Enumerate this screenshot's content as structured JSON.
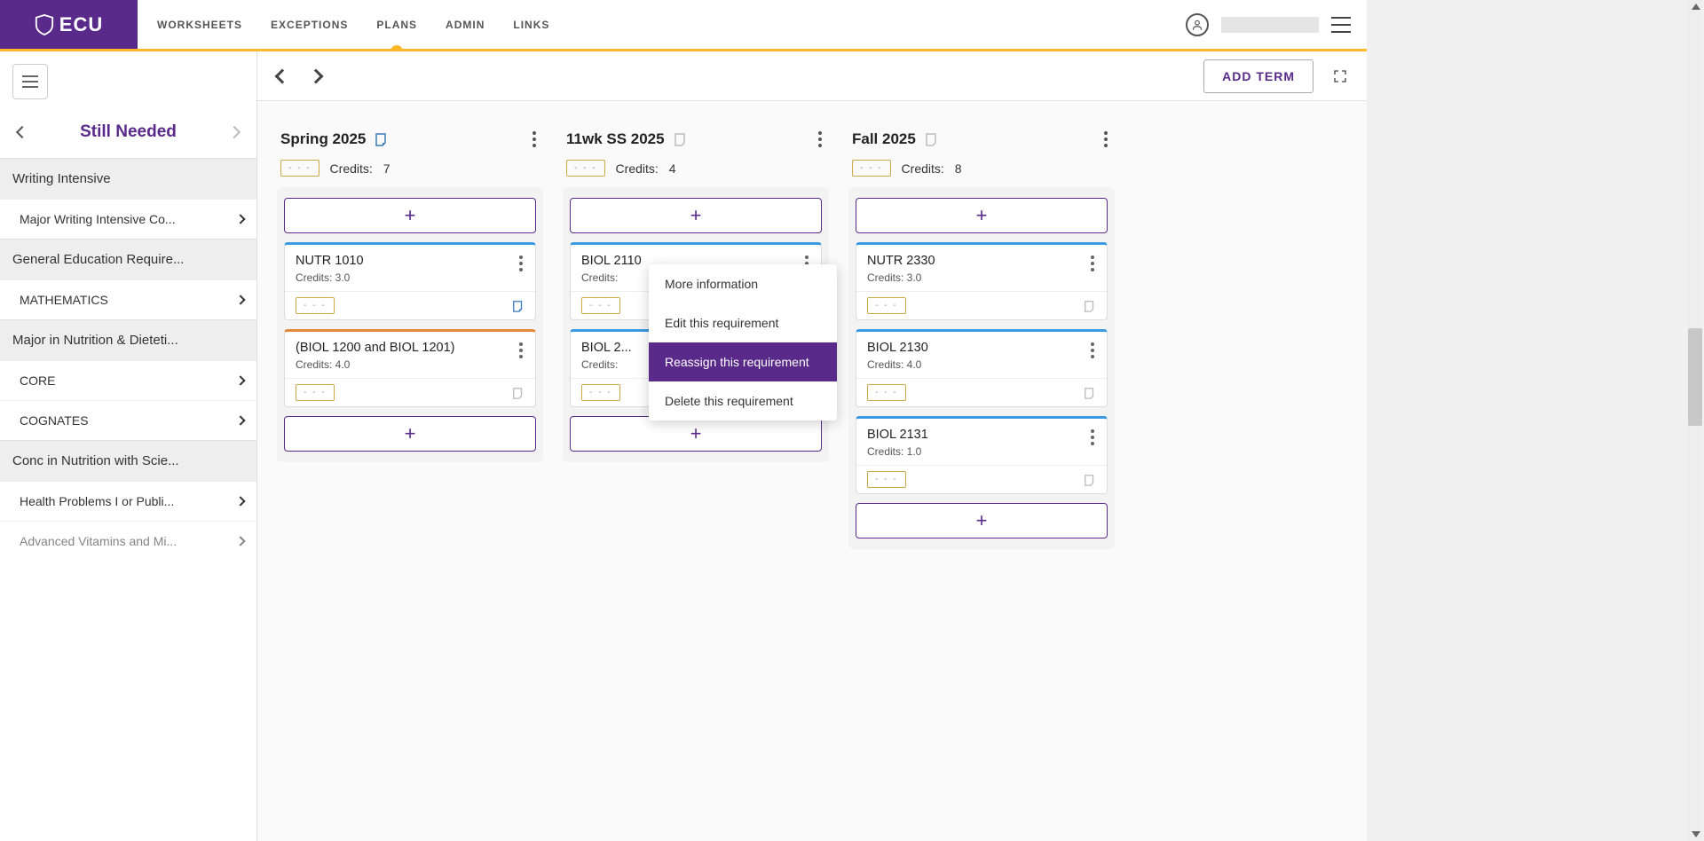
{
  "brand": "ECU",
  "nav": {
    "items": [
      "WORKSHEETS",
      "EXCEPTIONS",
      "PLANS",
      "ADMIN",
      "LINKS"
    ],
    "active_index": 2
  },
  "sidebar": {
    "title": "Still Needed",
    "groups": [
      {
        "type": "group",
        "label": "Writing Intensive"
      },
      {
        "type": "item",
        "label": "Major Writing Intensive Co..."
      },
      {
        "type": "group",
        "label": "General Education Require..."
      },
      {
        "type": "item",
        "label": "MATHEMATICS"
      },
      {
        "type": "group",
        "label": "Major in Nutrition & Dieteti..."
      },
      {
        "type": "item",
        "label": "CORE"
      },
      {
        "type": "item",
        "label": "COGNATES"
      },
      {
        "type": "group",
        "label": "Conc in Nutrition with Scie..."
      },
      {
        "type": "item",
        "label": "Health Problems I or Publi..."
      },
      {
        "type": "item",
        "label": "Advanced Vitamins and Mi..."
      }
    ]
  },
  "toolbar": {
    "add_term": "ADD TERM"
  },
  "dash_placeholder": "- - -",
  "credits_label": "Credits:",
  "terms": [
    {
      "title": "Spring 2025",
      "has_filled_note": true,
      "credits": "7",
      "courses": [
        {
          "name": "NUTR 1010",
          "credits": "Credits: 3.0",
          "accent": "blue",
          "note_filled": true
        },
        {
          "name": "(BIOL 1200 and BIOL 1201)",
          "credits": "Credits: 4.0",
          "accent": "orange",
          "note_filled": false
        }
      ]
    },
    {
      "title": "11wk SS 2025",
      "has_filled_note": false,
      "credits": "4",
      "courses": [
        {
          "name": "BIOL 2110",
          "credits": "Credits:",
          "accent": "blue",
          "note_filled": false,
          "menu_open": true
        },
        {
          "name": "BIOL 2...",
          "credits": "Credits:",
          "accent": "blue",
          "note_filled": false
        }
      ]
    },
    {
      "title": "Fall 2025",
      "has_filled_note": false,
      "credits": "8",
      "courses": [
        {
          "name": "NUTR 2330",
          "credits": "Credits: 3.0",
          "accent": "blue",
          "note_filled": false
        },
        {
          "name": "BIOL 2130",
          "credits": "Credits: 4.0",
          "accent": "blue",
          "note_filled": false
        },
        {
          "name": "BIOL 2131",
          "credits": "Credits: 1.0",
          "accent": "blue",
          "note_filled": false
        }
      ]
    }
  ],
  "context_menu": {
    "items": [
      "More information",
      "Edit this requirement",
      "Reassign this requirement",
      "Delete this requirement"
    ],
    "active_index": 2
  }
}
